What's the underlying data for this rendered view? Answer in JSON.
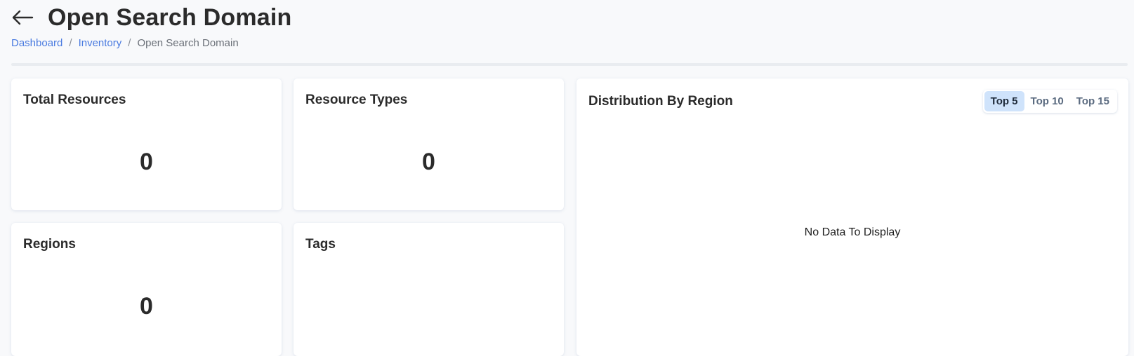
{
  "page": {
    "title": "Open Search Domain",
    "breadcrumb": [
      {
        "label": "Dashboard",
        "link": true
      },
      {
        "label": "Inventory",
        "link": true
      },
      {
        "label": "Open Search Domain",
        "link": false
      }
    ],
    "separator": "/"
  },
  "cards": {
    "total_resources": {
      "title": "Total Resources",
      "value": "0"
    },
    "resource_types": {
      "title": "Resource Types",
      "value": "0"
    },
    "regions": {
      "title": "Regions",
      "value": "0"
    },
    "tags": {
      "title": "Tags",
      "value": ""
    }
  },
  "distribution": {
    "title": "Distribution By Region",
    "toggles": [
      "Top 5",
      "Top 10",
      "Top 15"
    ],
    "selected": "Top 5",
    "empty_message": "No Data To Display"
  },
  "colors": {
    "link": "#4a7be0",
    "toggle_active_bg": "#cfe3fb",
    "background": "#f8f9fb"
  },
  "icons": {
    "back": "arrow-left-icon"
  }
}
